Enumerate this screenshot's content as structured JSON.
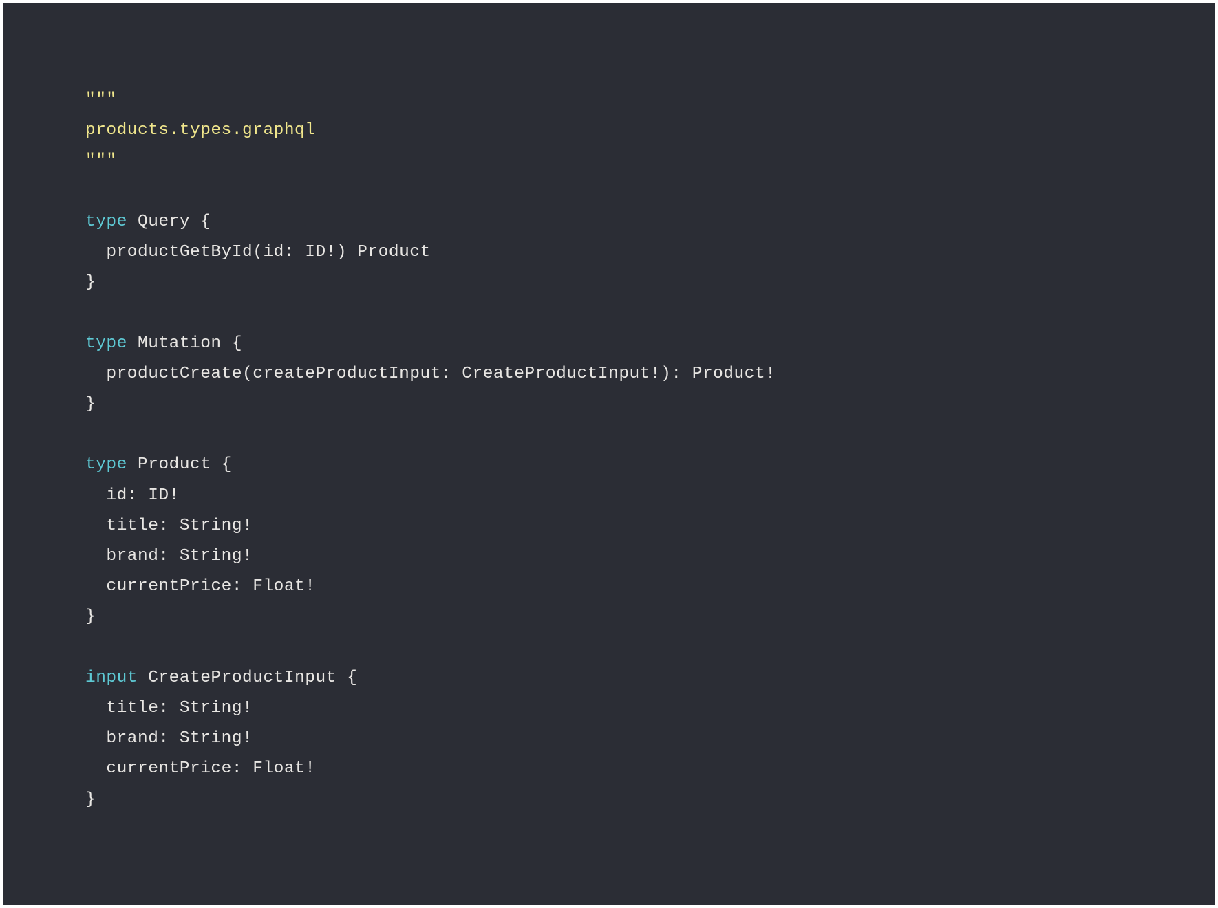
{
  "code": {
    "lines": [
      {
        "tokens": [
          {
            "cls": "string",
            "text": "\"\"\""
          }
        ]
      },
      {
        "tokens": [
          {
            "cls": "string",
            "text": "products.types.graphql"
          }
        ]
      },
      {
        "tokens": [
          {
            "cls": "string",
            "text": "\"\"\""
          }
        ]
      },
      {
        "tokens": []
      },
      {
        "tokens": [
          {
            "cls": "keyword",
            "text": "type"
          },
          {
            "cls": "text",
            "text": " Query {"
          }
        ]
      },
      {
        "tokens": [
          {
            "cls": "text",
            "text": "  productGetById(id: ID!) Product"
          }
        ]
      },
      {
        "tokens": [
          {
            "cls": "text",
            "text": "}"
          }
        ]
      },
      {
        "tokens": []
      },
      {
        "tokens": [
          {
            "cls": "keyword",
            "text": "type"
          },
          {
            "cls": "text",
            "text": " Mutation {"
          }
        ]
      },
      {
        "tokens": [
          {
            "cls": "text",
            "text": "  productCreate(createProductInput: CreateProductInput!): Product!"
          }
        ]
      },
      {
        "tokens": [
          {
            "cls": "text",
            "text": "}"
          }
        ]
      },
      {
        "tokens": []
      },
      {
        "tokens": [
          {
            "cls": "keyword",
            "text": "type"
          },
          {
            "cls": "text",
            "text": " Product {"
          }
        ]
      },
      {
        "tokens": [
          {
            "cls": "text",
            "text": "  id: ID!"
          }
        ]
      },
      {
        "tokens": [
          {
            "cls": "text",
            "text": "  title: String!"
          }
        ]
      },
      {
        "tokens": [
          {
            "cls": "text",
            "text": "  brand: String!"
          }
        ]
      },
      {
        "tokens": [
          {
            "cls": "text",
            "text": "  currentPrice: Float!"
          }
        ]
      },
      {
        "tokens": [
          {
            "cls": "text",
            "text": "}"
          }
        ]
      },
      {
        "tokens": []
      },
      {
        "tokens": [
          {
            "cls": "keyword",
            "text": "input"
          },
          {
            "cls": "text",
            "text": " CreateProductInput {"
          }
        ]
      },
      {
        "tokens": [
          {
            "cls": "text",
            "text": "  title: String!"
          }
        ]
      },
      {
        "tokens": [
          {
            "cls": "text",
            "text": "  brand: String!"
          }
        ]
      },
      {
        "tokens": [
          {
            "cls": "text",
            "text": "  currentPrice: Float!"
          }
        ]
      },
      {
        "tokens": [
          {
            "cls": "text",
            "text": "}"
          }
        ]
      }
    ]
  }
}
